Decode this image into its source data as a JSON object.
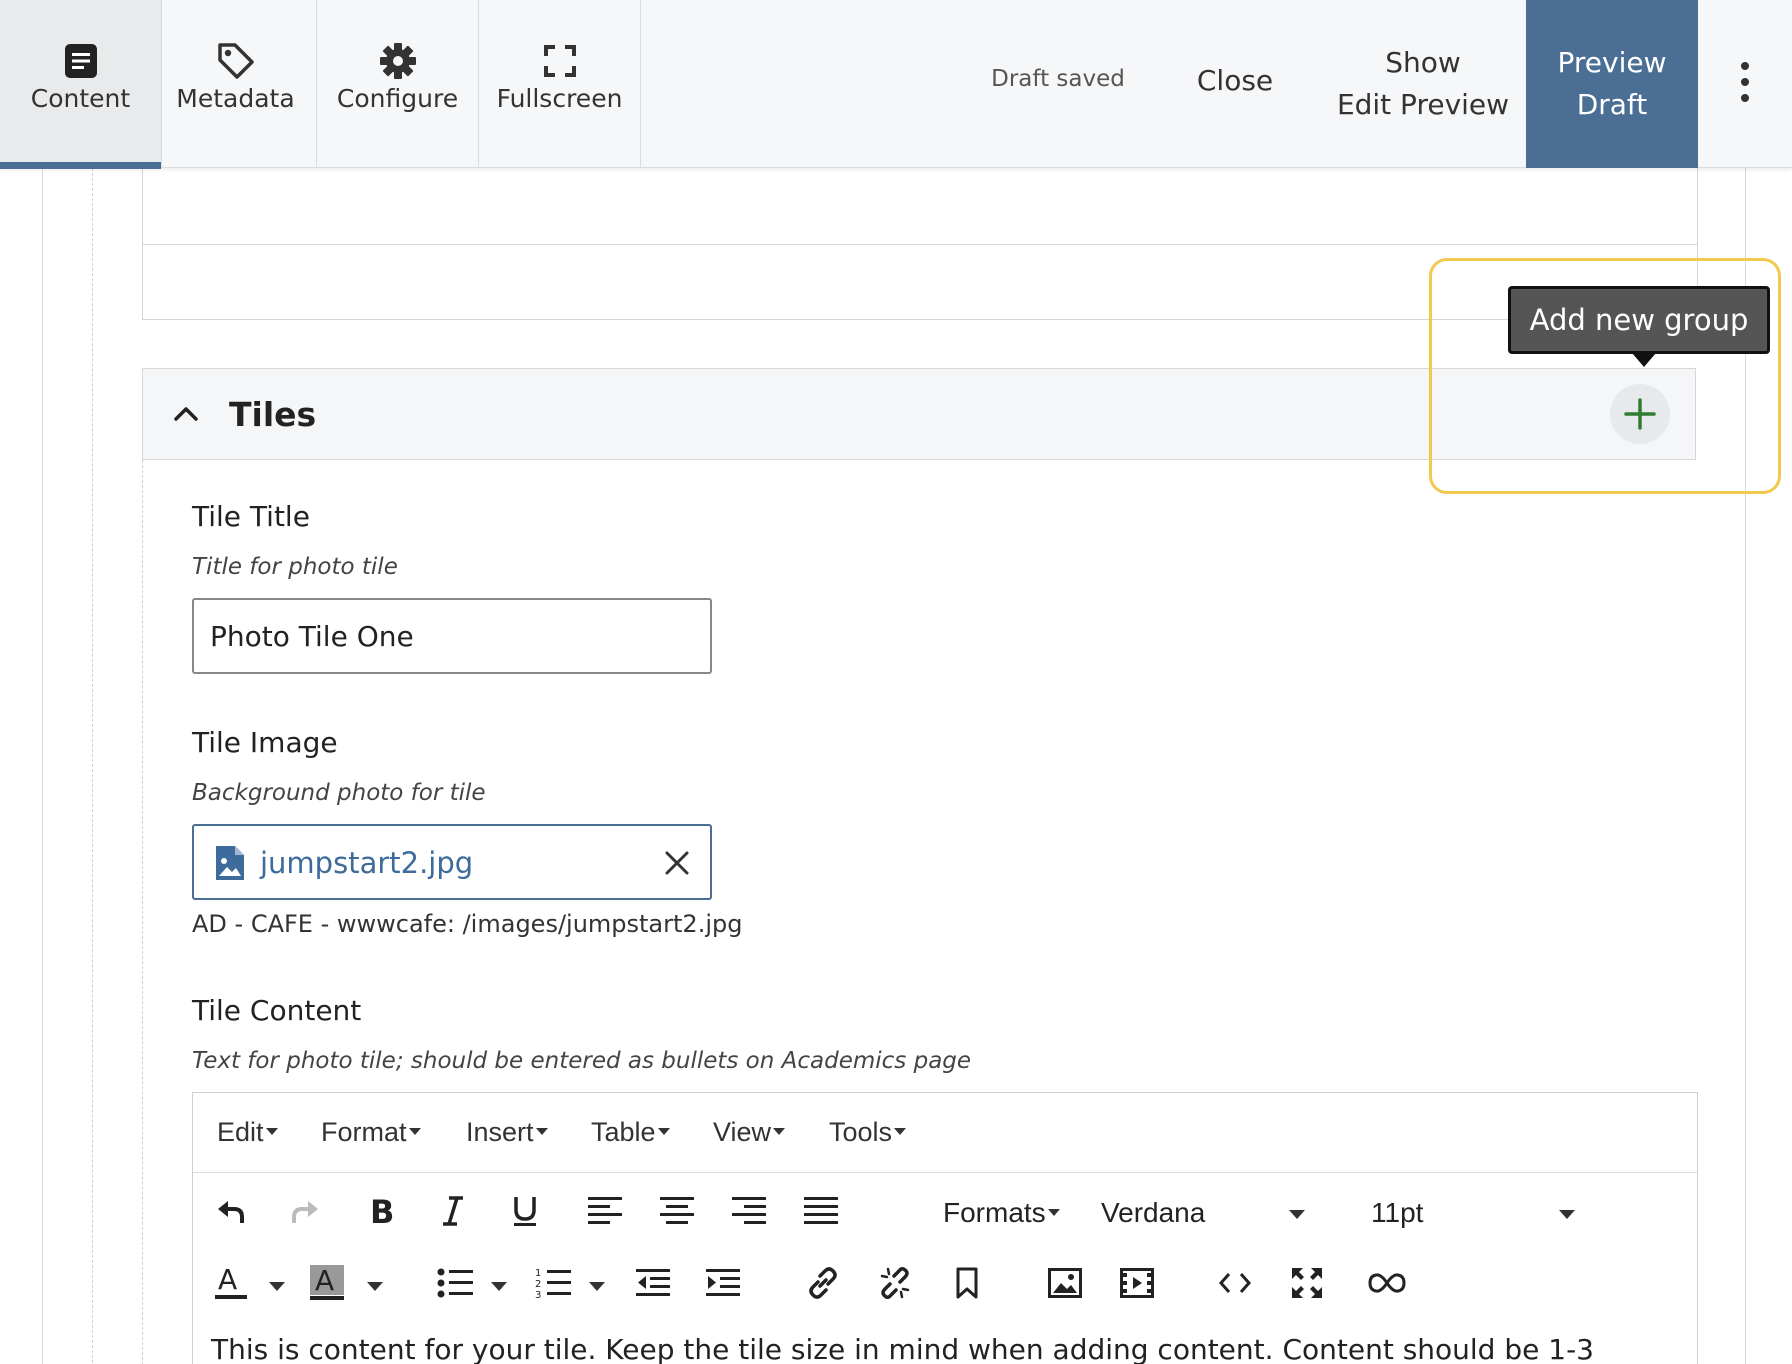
{
  "toolbar": {
    "tabs": [
      {
        "label": "Content",
        "icon": "content-icon",
        "active": true
      },
      {
        "label": "Metadata",
        "icon": "tag-icon"
      },
      {
        "label": "Configure",
        "icon": "gear-icon"
      },
      {
        "label": "Fullscreen",
        "icon": "fullscreen-icon"
      }
    ],
    "status": "Draft saved",
    "close_label": "Close",
    "show_label_line1": "Show",
    "show_label_line2": "Edit Preview",
    "preview_line1": "Preview",
    "preview_line2": "Draft",
    "accent_color": "#4b6e95"
  },
  "group": {
    "title": "Tiles",
    "add_tooltip": "Add new group",
    "add_icon_color": "#2e7d32",
    "highlight_color": "#f2c94c"
  },
  "fields": {
    "tile_title": {
      "label": "Tile Title",
      "help": "Title for photo tile",
      "value": "Photo Tile One"
    },
    "tile_image": {
      "label": "Tile Image",
      "help": "Background photo for tile",
      "file_name": "jumpstart2.jpg",
      "path": "AD - CAFE - wwwcafe: /images/jumpstart2.jpg"
    },
    "tile_content": {
      "label": "Tile Content",
      "help": "Text for photo tile; should be entered as bullets on Academics page"
    }
  },
  "editor": {
    "menus": [
      "Edit",
      "Format",
      "Insert",
      "Table",
      "View",
      "Tools"
    ],
    "formats_label": "Formats",
    "font_family": "Verdana",
    "font_size": "11pt",
    "body_text": "This is content for your tile. Keep the tile size in mind when adding content. Content should be 1-3"
  }
}
